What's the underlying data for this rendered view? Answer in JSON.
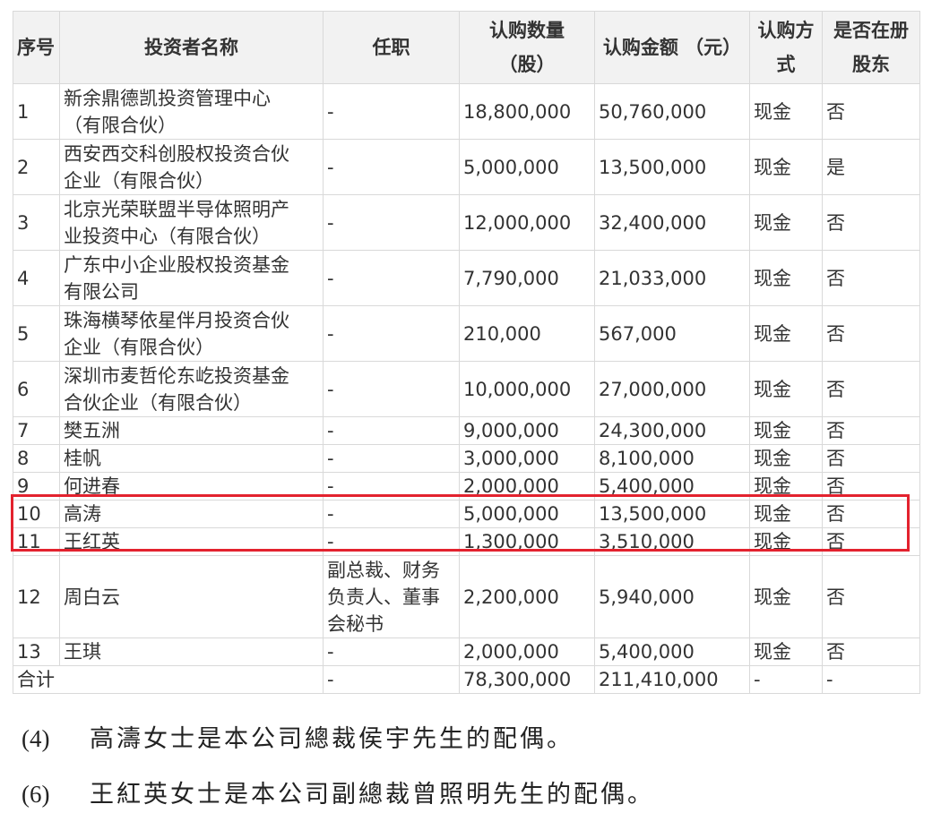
{
  "table": {
    "headers": {
      "index": "序号",
      "name": "投资者名称",
      "position": "任职",
      "shares_line1": "认购数量",
      "shares_line2": "（股）",
      "amount": "认购金额 （元）",
      "method_line1": "认购方",
      "method_line2": "式",
      "registered_line1": "是否在册",
      "registered_line2": "股东"
    },
    "rows": [
      {
        "idx": "1",
        "name_l1": "新余鼎德凯投资管理中心",
        "name_l2": "（有限合伙）",
        "position": "-",
        "shares": "18,800,000",
        "amount": "50,760,000",
        "method": "现金",
        "registered": "否"
      },
      {
        "idx": "2",
        "name_l1": "西安西交科创股权投资合伙",
        "name_l2": "企业（有限合伙）",
        "position": "-",
        "shares": "5,000,000",
        "amount": "13,500,000",
        "method": "现金",
        "registered": "是"
      },
      {
        "idx": "3",
        "name_l1": "北京光荣联盟半导体照明产",
        "name_l2": "业投资中心（有限合伙）",
        "position": "-",
        "shares": "12,000,000",
        "amount": "32,400,000",
        "method": "现金",
        "registered": "否"
      },
      {
        "idx": "4",
        "name_l1": "广东中小企业股权投资基金",
        "name_l2": "有限公司",
        "position": "-",
        "shares": "7,790,000",
        "amount": "21,033,000",
        "method": "现金",
        "registered": "否"
      },
      {
        "idx": "5",
        "name_l1": "珠海横琴依星伴月投资合伙",
        "name_l2": "企业（有限合伙）",
        "position": "-",
        "shares": "210,000",
        "amount": "567,000",
        "method": "现金",
        "registered": "否"
      },
      {
        "idx": "6",
        "name_l1": "深圳市麦哲伦东屹投资基金",
        "name_l2": "合伙企业（有限合伙）",
        "position": "-",
        "shares": "10,000,000",
        "amount": "27,000,000",
        "method": "现金",
        "registered": "否"
      },
      {
        "idx": "7",
        "name": "樊五洲",
        "position": "-",
        "shares": "9,000,000",
        "amount": "24,300,000",
        "method": "现金",
        "registered": "否"
      },
      {
        "idx": "8",
        "name": "桂帆",
        "position": "-",
        "shares": "3,000,000",
        "amount": "8,100,000",
        "method": "现金",
        "registered": "否"
      },
      {
        "idx": "9",
        "name": "何进春",
        "position": "-",
        "shares": "2,000,000",
        "amount": "5,400,000",
        "method": "现金",
        "registered": "否"
      },
      {
        "idx": "10",
        "name": "高涛",
        "position": "-",
        "shares": "5,000,000",
        "amount": "13,500,000",
        "method": "现金",
        "registered": "否"
      },
      {
        "idx": "11",
        "name": "王红英",
        "position": "-",
        "shares": "1,300,000",
        "amount": "3,510,000",
        "method": "现金",
        "registered": "否"
      },
      {
        "idx": "12",
        "name": "周白云",
        "position_l1": "副总裁、财务",
        "position_l2": "负责人、董事",
        "position_l3": "会秘书",
        "shares": "2,200,000",
        "amount": "5,940,000",
        "method": "现金",
        "registered": "否"
      },
      {
        "idx": "13",
        "name": "王琪",
        "position": "-",
        "shares": "2,000,000",
        "amount": "5,400,000",
        "method": "现金",
        "registered": "否"
      }
    ],
    "total": {
      "label": "合计",
      "position": "-",
      "shares": "78,300,000",
      "amount": "211,410,000",
      "method": "-",
      "registered": "-"
    }
  },
  "notes": [
    {
      "marker": "(4)",
      "text": "高濤女士是本公司總裁侯宇先生的配偶。"
    },
    {
      "marker": "(6)",
      "text": "王紅英女士是本公司副總裁曾照明先生的配偶。"
    }
  ],
  "colors": {
    "highlight": "#e3222e",
    "header_bg": "#f2f2f2",
    "border": "#d9d9d9"
  }
}
